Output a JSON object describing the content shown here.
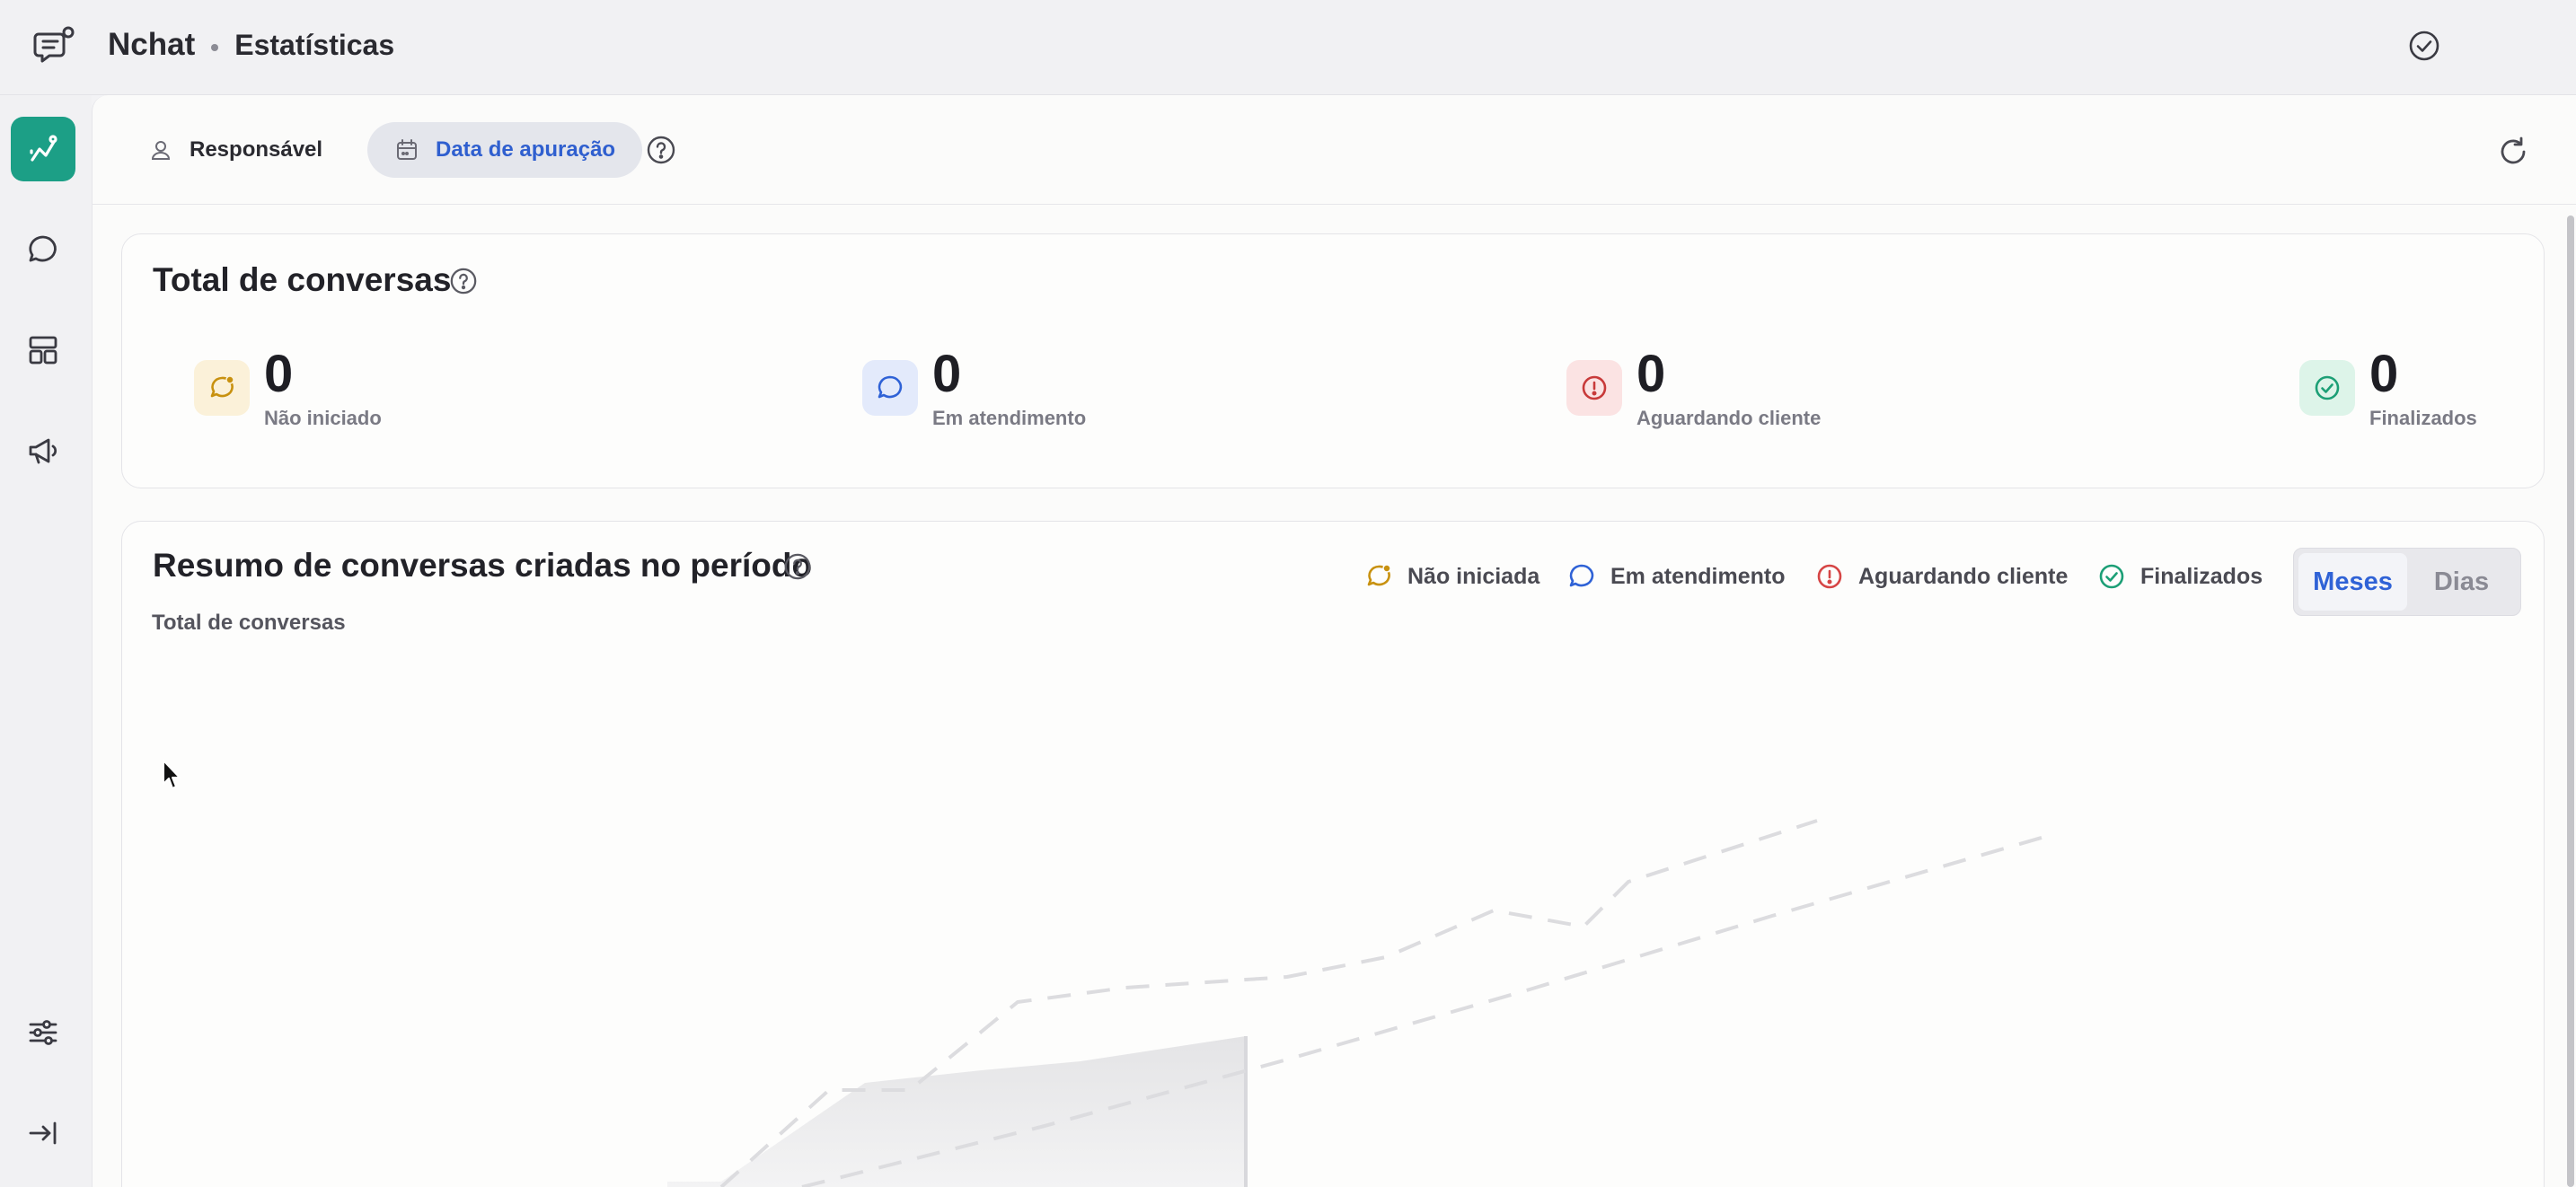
{
  "header": {
    "app_name": "Nchat",
    "page_name": "Estatísticas",
    "app_icon": "chat-bubble-icon",
    "status_icon": "check-circle-icon"
  },
  "sidebar": {
    "items": [
      {
        "icon": "analytics-icon",
        "active": true
      },
      {
        "icon": "chat-icon",
        "active": false
      },
      {
        "icon": "layout-icon",
        "active": false
      },
      {
        "icon": "megaphone-icon",
        "active": false
      }
    ],
    "bottom": [
      {
        "icon": "sliders-icon"
      },
      {
        "icon": "collapse-icon"
      }
    ]
  },
  "filters": {
    "responsible_label": "Responsável",
    "date_label": "Data de apuração"
  },
  "totals": {
    "title": "Total de conversas",
    "stats": [
      {
        "value": "0",
        "label": "Não iniciado",
        "color": "#d9a21b",
        "bg": "#fbf1d9"
      },
      {
        "value": "0",
        "label": "Em atendimento",
        "color": "#2f62d6",
        "bg": "#e3eafb"
      },
      {
        "value": "0",
        "label": "Aguardando cliente",
        "color": "#d64545",
        "bg": "#fbe3e3"
      },
      {
        "value": "0",
        "label": "Finalizados",
        "color": "#1c9f76",
        "bg": "#ddf4e9"
      }
    ]
  },
  "summary": {
    "title": "Resumo de conversas criadas no período",
    "subtitle": "Total de conversas",
    "legend": [
      {
        "label": "Não iniciada",
        "color": "#d9a21b"
      },
      {
        "label": "Em atendimento",
        "color": "#2f62d6"
      },
      {
        "label": "Aguardando cliente",
        "color": "#d64545"
      },
      {
        "label": "Finalizados",
        "color": "#1c9f76"
      }
    ],
    "toggle": {
      "months": "Meses",
      "days": "Dias",
      "selected": "months"
    }
  },
  "colors": {
    "accent": "#1c9f86",
    "link": "#2f62d6"
  }
}
